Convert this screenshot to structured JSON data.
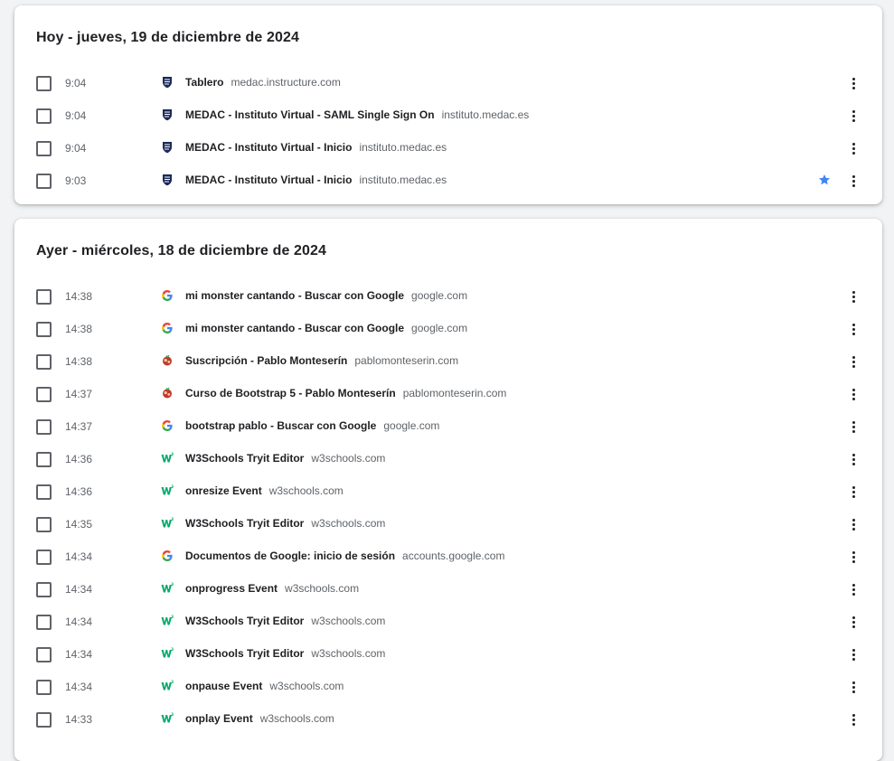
{
  "today": {
    "title": "Hoy - jueves, 19 de diciembre de 2024",
    "items": [
      {
        "time": "9:04",
        "title": "Tablero",
        "domain": "medac.instructure.com",
        "icon": "medac-shield-icon",
        "starred": false
      },
      {
        "time": "9:04",
        "title": "MEDAC - Instituto Virtual - SAML Single Sign On",
        "domain": "instituto.medac.es",
        "icon": "medac-shield-icon",
        "starred": false
      },
      {
        "time": "9:04",
        "title": "MEDAC - Instituto Virtual - Inicio",
        "domain": "instituto.medac.es",
        "icon": "medac-shield-icon",
        "starred": false
      },
      {
        "time": "9:03",
        "title": "MEDAC - Instituto Virtual - Inicio",
        "domain": "instituto.medac.es",
        "icon": "medac-shield-icon",
        "starred": true
      }
    ]
  },
  "yesterday": {
    "title": "Ayer - miércoles, 18 de diciembre de 2024",
    "items": [
      {
        "time": "14:38",
        "title": "mi monster cantando - Buscar con Google",
        "domain": "google.com",
        "icon": "google-icon"
      },
      {
        "time": "14:38",
        "title": "mi monster cantando - Buscar con Google",
        "domain": "google.com",
        "icon": "google-icon"
      },
      {
        "time": "14:38",
        "title": "Suscripción - Pablo Monteserín",
        "domain": "pablomonteserin.com",
        "icon": "pablomonteserin-icon"
      },
      {
        "time": "14:37",
        "title": "Curso de Bootstrap 5 - Pablo Monteserín",
        "domain": "pablomonteserin.com",
        "icon": "pablomonteserin-icon"
      },
      {
        "time": "14:37",
        "title": "bootstrap pablo - Buscar con Google",
        "domain": "google.com",
        "icon": "google-icon"
      },
      {
        "time": "14:36",
        "title": "W3Schools Tryit Editor",
        "domain": "w3schools.com",
        "icon": "w3schools-icon"
      },
      {
        "time": "14:36",
        "title": "onresize Event",
        "domain": "w3schools.com",
        "icon": "w3schools-icon"
      },
      {
        "time": "14:35",
        "title": "W3Schools Tryit Editor",
        "domain": "w3schools.com",
        "icon": "w3schools-icon"
      },
      {
        "time": "14:34",
        "title": "Documentos de Google: inicio de sesión",
        "domain": "accounts.google.com",
        "icon": "google-icon"
      },
      {
        "time": "14:34",
        "title": "onprogress Event",
        "domain": "w3schools.com",
        "icon": "w3schools-icon"
      },
      {
        "time": "14:34",
        "title": "W3Schools Tryit Editor",
        "domain": "w3schools.com",
        "icon": "w3schools-icon"
      },
      {
        "time": "14:34",
        "title": "W3Schools Tryit Editor",
        "domain": "w3schools.com",
        "icon": "w3schools-icon"
      },
      {
        "time": "14:34",
        "title": "onpause Event",
        "domain": "w3schools.com",
        "icon": "w3schools-icon"
      },
      {
        "time": "14:33",
        "title": "onplay Event",
        "domain": "w3schools.com",
        "icon": "w3schools-icon"
      }
    ]
  },
  "colors": {
    "star": "#4285f4",
    "medac": "#1a2a5a",
    "w3schools": "#04aa6d"
  }
}
